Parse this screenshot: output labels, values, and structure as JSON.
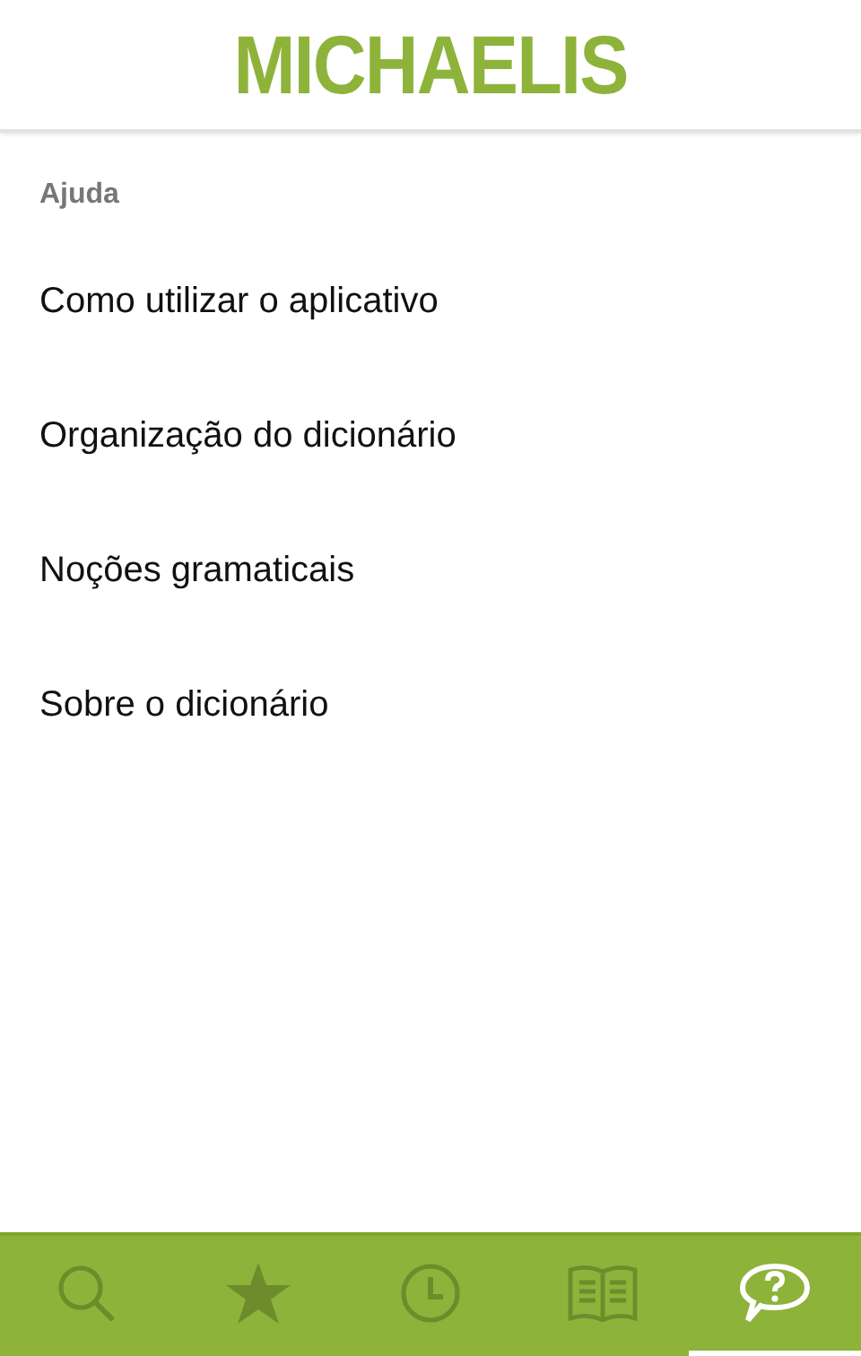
{
  "header": {
    "logo": "MICHAELIS"
  },
  "section_title": "Ajuda",
  "items": [
    {
      "label": "Como utilizar o aplicativo"
    },
    {
      "label": "Organização do dicionário"
    },
    {
      "label": "Noções gramaticais"
    },
    {
      "label": "Sobre o dicionário"
    }
  ],
  "tabs": [
    {
      "kind": "search",
      "selected": false
    },
    {
      "kind": "favorites",
      "selected": false
    },
    {
      "kind": "history",
      "selected": false
    },
    {
      "kind": "book",
      "selected": false
    },
    {
      "kind": "help",
      "selected": true
    }
  ]
}
